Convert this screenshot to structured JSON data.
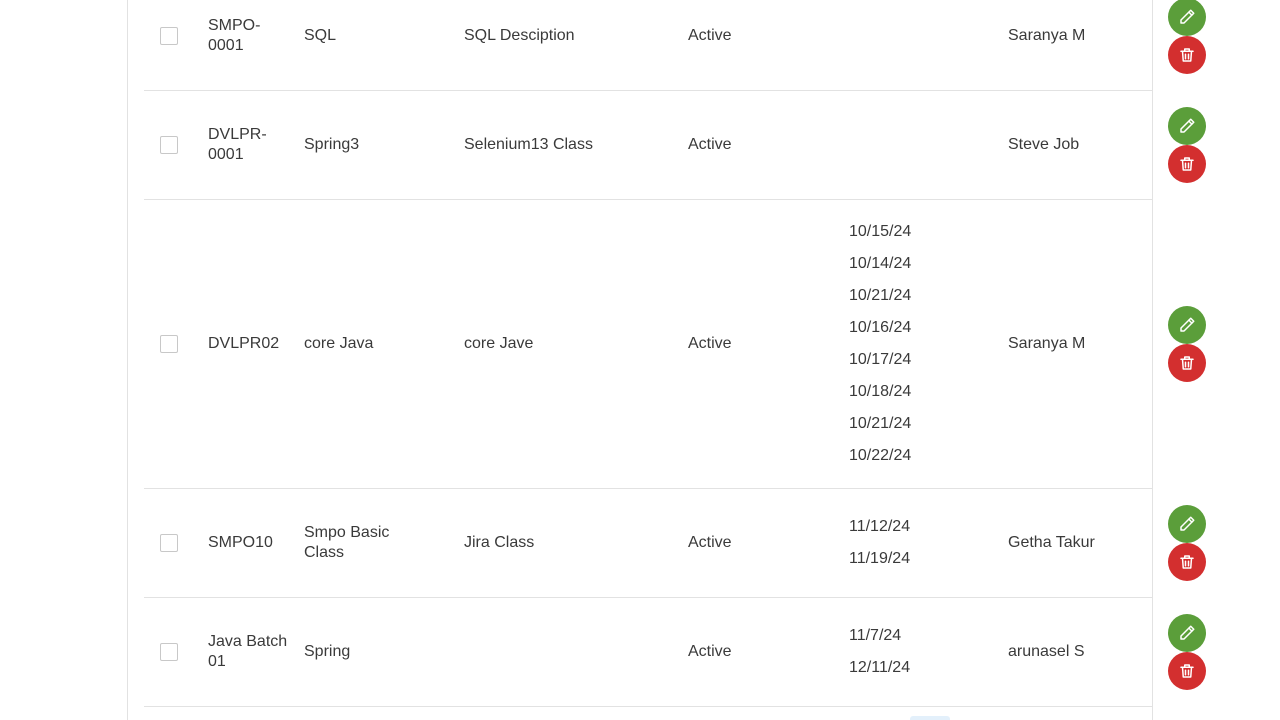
{
  "colors": {
    "edit_button": "#5b9e3a",
    "delete_button": "#d32f2f",
    "divider": "#e2e2e2"
  },
  "icons": {
    "edit": "pencil-icon",
    "delete": "trash-icon"
  },
  "rows": [
    {
      "code": "SMPO-0001",
      "name": "SQL",
      "description": "SQL Desciption",
      "status": "Active",
      "dates": [],
      "trainer": "Saranya M"
    },
    {
      "code": "DVLPR-0001",
      "name": "Spring3",
      "description": "Selenium13 Class",
      "status": "Active",
      "dates": [],
      "trainer": "Steve Job"
    },
    {
      "code": "DVLPR02",
      "name": "core Java",
      "description": "core Jave",
      "status": "Active",
      "dates": [
        "10/15/24",
        "10/14/24",
        "10/21/24",
        "10/16/24",
        "10/17/24",
        "10/18/24",
        "10/21/24",
        "10/22/24"
      ],
      "trainer": "Saranya M"
    },
    {
      "code": "SMPO10",
      "name": "Smpo Basic Class",
      "description": "Jira Class",
      "status": "Active",
      "dates": [
        "11/12/24",
        "11/19/24"
      ],
      "trainer": "Getha Takur"
    },
    {
      "code": "Java Batch 01",
      "name": "Spring",
      "description": "",
      "status": "Active",
      "dates": [
        "11/7/24",
        "12/11/24"
      ],
      "trainer": "arunasel S"
    }
  ]
}
